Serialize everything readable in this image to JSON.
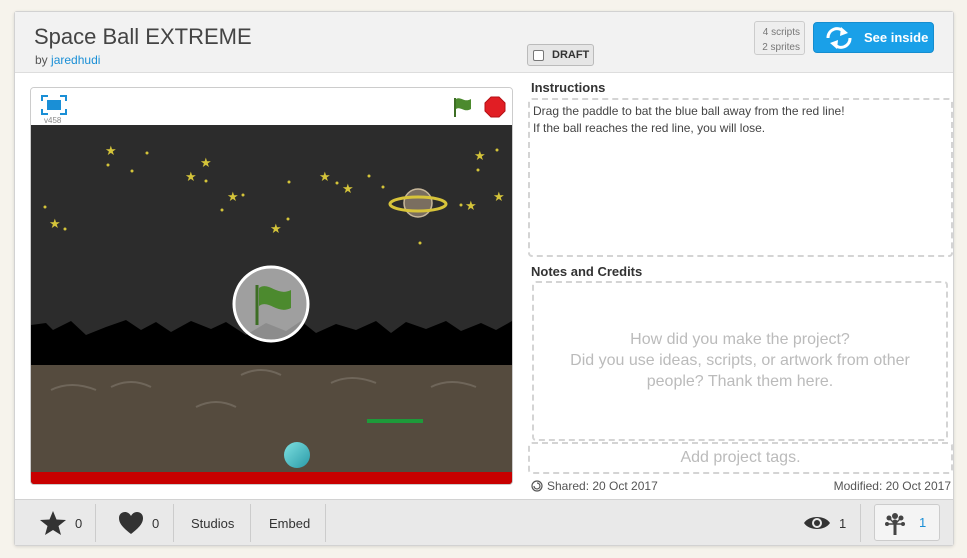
{
  "project": {
    "title": "Space Ball EXTREME",
    "by_label": "by",
    "author": "jaredhudi",
    "draft_label": "DRAFT",
    "scripts_count": "4 scripts",
    "sprites_count": "2 sprites",
    "see_inside_label": "See inside"
  },
  "player": {
    "version": "v458",
    "icons": {
      "fullscreen": "fullscreen-icon",
      "green_flag": "green-flag-icon",
      "stop": "stop-icon",
      "play_overlay": "green-flag-play-icon"
    }
  },
  "instructions": {
    "title": "Instructions",
    "line1": "Drag the paddle to bat the blue ball away from the red line!",
    "line2": "If the ball reaches the red line, you will lose."
  },
  "notes": {
    "title": "Notes and Credits",
    "placeholder_line1": "How did you make the project?",
    "placeholder_line2": "Did you use ideas, scripts, or artwork from other",
    "placeholder_line3": "people? Thank them here."
  },
  "tags": {
    "placeholder": "Add project tags."
  },
  "dates": {
    "shared": "Shared: 20 Oct 2017",
    "modified": "Modified: 20 Oct 2017"
  },
  "footer": {
    "stars_count": "0",
    "loves_count": "0",
    "studios_label": "Studios",
    "embed_label": "Embed",
    "views_count": "1",
    "remix_count": "1"
  },
  "colors": {
    "accent": "#1aa0e8",
    "link": "#1a8fd6",
    "flag_green": "#4c8a2e",
    "stop_red": "#e11e24",
    "stage_sky": "#2c2c2c",
    "stage_ground": "#554b3e",
    "red_line": "#c80000",
    "paddle": "#1e9a3a"
  }
}
